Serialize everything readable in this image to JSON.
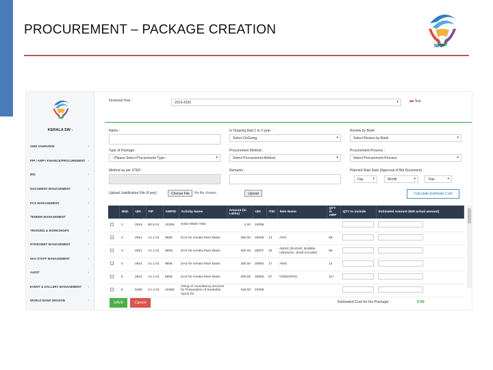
{
  "slide": {
    "title": "PROCUREMENT – PACKAGE CREATION",
    "logo_text": "NHP",
    "colors": {
      "accent": "#4a7ab8",
      "rule": "#b7585a",
      "green": "#3a9a43"
    }
  },
  "sidebar": {
    "brand": "KERALA SW -",
    "items": [
      "AWD OVERVIEW",
      "PIP / AWP / FINANCE/PROCUREMENT",
      "MIS",
      "DOCUMENT MANAGEMENT",
      "PCS MANAGEMENT",
      "TENDER MANAGEMENT",
      "TRAINING & WORKSHOPS",
      "HYDROMET MANAGEMENT",
      "IHAI STAFF MANAGEMENT",
      "AUDIT",
      "EVENT & GALLERY MANAGEMENT",
      "WORLD BANK MISSION"
    ]
  },
  "form": {
    "financial_year_label": "Financial Year :",
    "financial_year_value": "2019-2020",
    "corner_badge": "Test",
    "name_label": "Name :",
    "ongoing_label": "Is Ongoing (last 1 to 3 year :",
    "ongoing_value": "Select OnGoing",
    "review_label": "Review by Bank :",
    "review_value": "Select Review by Bank",
    "package_type_label": "Type of Package :",
    "package_type_value": "--Please Select Procurement Type--",
    "method_label": "Procurement Method :",
    "method_value": "Select Procurement Method",
    "process_label": "Procurement Process :",
    "process_value": "Select Procurement Process",
    "step_label": "Method as per STEP :",
    "remarks_label": "Remarks :",
    "start_date_label": "Planned Start Date (Approval of Bid Document) :",
    "day_value": "Day",
    "month_value": "Month",
    "year_value": "Year",
    "upload_label": "Upload Justification File (if any) :",
    "choose_file": "Choose File",
    "no_file": "No file chosen",
    "upload_button": "Upload",
    "calc_button": "Calculate Estimate Cost"
  },
  "table": {
    "headers": [
      "",
      "IIND.",
      "UID",
      "PIP",
      "AWPID",
      "Activity Name",
      "Amount (in Lakhs)",
      "UID",
      "ITID",
      "Item Name",
      "QTY in AWP",
      "QTY to include",
      "Estimated Amount (INR actual amount)"
    ],
    "rows": [
      [
        "1",
        "2918",
        "B0.5.01",
        "10259",
        "Solar Water Atlas",
        "2.00",
        "10069",
        "",
        "",
        ""
      ],
      [
        "2",
        "2821",
        "A1.1.01",
        "9608",
        "DAS for Kerala River Basin",
        "300.00",
        "25006",
        "13",
        "ARG",
        "68"
      ],
      [
        "3",
        "2821",
        "A1.1.01",
        "9609",
        "DAS for Kerala River Basin",
        "300.00",
        "25007",
        "16",
        "AWLR (RADAR, Bubbler, Ultrasonic, Shaft encoder)",
        "55"
      ],
      [
        "4",
        "2821",
        "A1.1.01",
        "9608",
        "DAS for Kerala River Basin",
        "300.00",
        "25993",
        "17",
        "AWS",
        "14"
      ],
      [
        "5",
        "2821",
        "A1.1.01",
        "9608",
        "DAS for Kerala River Basin",
        "300.00",
        "25993",
        "57",
        "GSM/GPRS",
        "117"
      ],
      [
        "6",
        "6455",
        "C1.1.01",
        "10286",
        "Hiring of consultancy services for Preparation of Seekable report for",
        "150.00",
        "10288",
        "",
        "",
        ""
      ]
    ]
  },
  "footer": {
    "save": "SAVE",
    "cancel": "Cancel",
    "estimated_label": "Estimated Cost for the Package :",
    "estimated_value": "0.00"
  }
}
